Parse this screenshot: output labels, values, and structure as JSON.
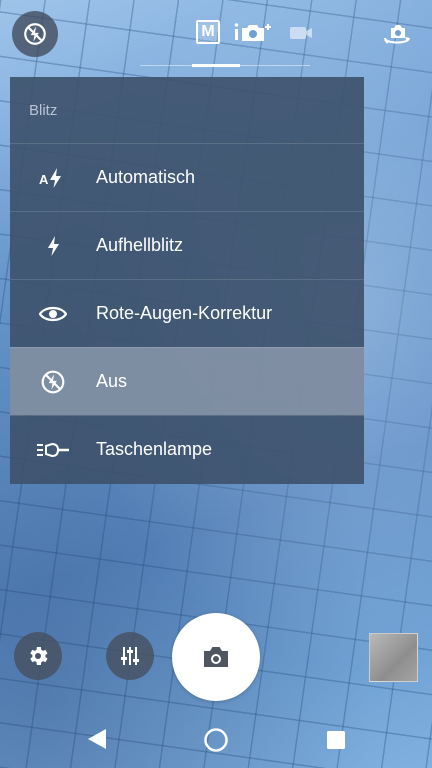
{
  "flash_menu": {
    "title": "Blitz",
    "items": [
      {
        "label": "Automatisch",
        "icon": "flash-auto-icon",
        "selected": false
      },
      {
        "label": "Aufhellblitz",
        "icon": "flash-on-icon",
        "selected": false
      },
      {
        "label": "Rote-Augen-Korrektur",
        "icon": "eye-icon",
        "selected": false
      },
      {
        "label": "Aus",
        "icon": "flash-off-icon",
        "selected": true
      },
      {
        "label": "Taschenlampe",
        "icon": "torch-icon",
        "selected": false
      }
    ]
  },
  "top_bar": {
    "mode_label": "M",
    "icons": [
      "flash-off-icon",
      "manual-mode-icon",
      "superior-auto-icon",
      "video-mode-icon",
      "switch-camera-icon"
    ]
  },
  "colors": {
    "menu_background": "#3e526c",
    "menu_selected": "#8a98aa",
    "menu_title": "#b8c4d2"
  }
}
